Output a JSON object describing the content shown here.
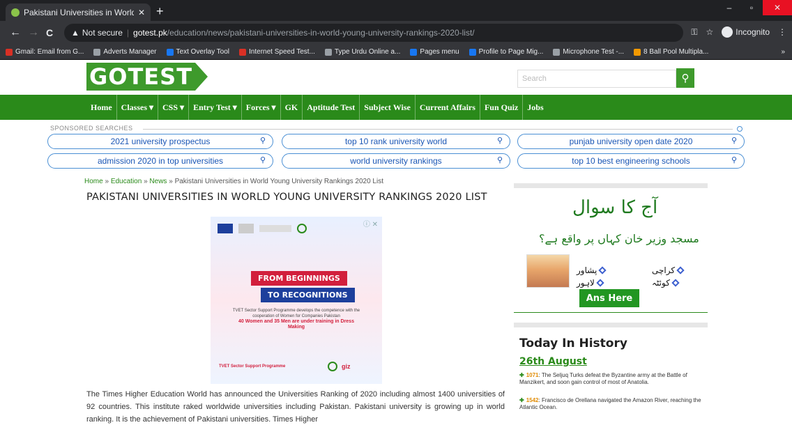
{
  "browser": {
    "tab_title": "Pakistani Universities in World Yo",
    "tab_close": "✕",
    "new_tab": "+",
    "window_controls": [
      "–",
      "▫",
      "✕"
    ],
    "back": "←",
    "forward": "→",
    "reload": "C",
    "security": "Not secure",
    "url_host": "gotest.pk",
    "url_path": "/education/news/pakistani-universities-in-world-young-university-rankings-2020-list/",
    "incognito": "Incognito",
    "bookmarks": [
      {
        "label": "Gmail: Email from G...",
        "icon": "mail-icon"
      },
      {
        "label": "Adverts Manager",
        "icon": "ads-icon"
      },
      {
        "label": "Text Overlay Tool",
        "icon": "facebook-icon"
      },
      {
        "label": "Internet Speed Test...",
        "icon": "speed-icon"
      },
      {
        "label": "Type Urdu Online a...",
        "icon": "globe-icon"
      },
      {
        "label": "Pages menu",
        "icon": "facebook-icon"
      },
      {
        "label": "Profile to Page Mig...",
        "icon": "facebook-icon"
      },
      {
        "label": "Microphone Test -...",
        "icon": "globe-icon"
      },
      {
        "label": "8 Ball Pool Multipla...",
        "icon": "game-icon"
      }
    ],
    "bookmarks_more": "»"
  },
  "site": {
    "logo": "GOTEST",
    "search_placeholder": "Search",
    "search_button": "🔍",
    "nav": [
      "Home",
      "Classes ▾",
      "CSS ▾",
      "Entry Test ▾",
      "Forces ▾",
      "GK",
      "Aptitude Test",
      "Subject Wise",
      "Current Affairs",
      "Fun Quiz",
      "Jobs"
    ]
  },
  "sponsored": {
    "label": "SPONSORED SEARCHES",
    "items": [
      "2021 university prospectus",
      "top 10 rank university world",
      "punjab university open date 2020",
      "admission 2020 in top universities",
      "world university rankings",
      "top 10 best engineering schools"
    ]
  },
  "article": {
    "breadcrumb": [
      "Home",
      "Education",
      "News",
      "Pakistani Universities in World Young University Rankings 2020 List"
    ],
    "breadcrumb_sep": "»",
    "title": "PAKISTANI UNIVERSITIES IN WORLD YOUNG UNIVERSITY RANKINGS 2020 LIST",
    "ad": {
      "close": "ⓘ ✕",
      "heading1": "FROM BEGINNINGS",
      "heading2": "TO RECOGNITIONS",
      "body": "TVET Sector Support Programme develops the competence with the cooperation of Women for Companies Pakistan",
      "highlight": "40 Women and 35 Men are under training in Dress Making",
      "footer": "TVET Sector Support Programme",
      "footer_brand": "giz"
    },
    "paragraph": "The Times Higher Education World has announced the Universities Ranking of 2020 including almost 1400 universities of 92 countries. This institute raked worldwide universities including Pakistan. Pakistani university is growing up in world ranking. It is the achievement of Pakistani universities. Times Higher"
  },
  "sidebar": {
    "quiz_heading": "آج کا سوال",
    "quiz_question": "مسجد وزیر خان کہاں پر واقع ہے؟",
    "options": [
      "کراچی",
      "پشاور",
      "کوئٹہ",
      "لاہور"
    ],
    "answer_button": "Ans Here",
    "history_title": "Today In History",
    "history_date": "26th August",
    "history": [
      {
        "year": "1071",
        "text": "The Seljuq Turks defeat the Byzantine army at the Battle of Manzikert, and soon gain control of most of Anatolia."
      },
      {
        "year": "1542",
        "text": "Francisco de Orellana navigated the Amazon River, reaching the Atlantic Ocean."
      }
    ]
  }
}
